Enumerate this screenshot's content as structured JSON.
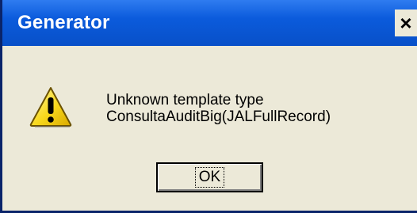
{
  "window": {
    "title": "Generator",
    "close_glyph": "×"
  },
  "message": {
    "line1": "Unknown template type",
    "line2": "ConsultaAuditBig(JALFullRecord)"
  },
  "buttons": {
    "ok_label": "OK"
  },
  "icons": {
    "warning": "warning-triangle-icon",
    "close": "close-icon"
  },
  "colors": {
    "titlebar": "#0b5bdc",
    "dialog_bg": "#ece9d8",
    "warning_fill": "#f8d81c"
  }
}
